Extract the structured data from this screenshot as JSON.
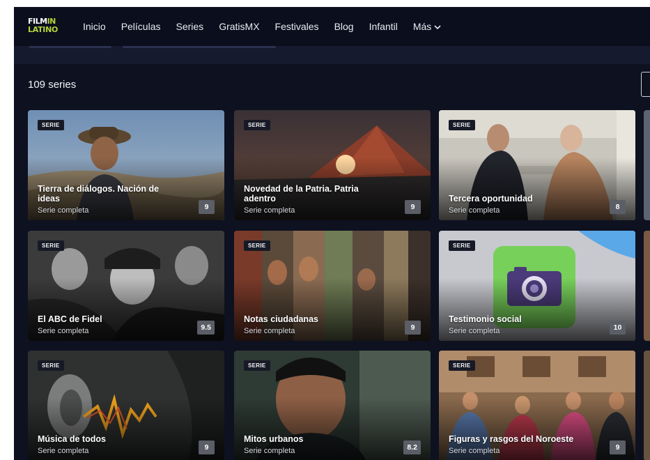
{
  "app": {
    "logo_line1_a": "FILM",
    "logo_line1_b": "IN",
    "logo_line2": "LATINO"
  },
  "nav": {
    "items": [
      {
        "label": "Inicio"
      },
      {
        "label": "Películas"
      },
      {
        "label": "Series"
      },
      {
        "label": "GratisMX"
      },
      {
        "label": "Festivales"
      },
      {
        "label": "Blog"
      },
      {
        "label": "Infantil"
      },
      {
        "label": "Más"
      }
    ]
  },
  "catalog": {
    "count_label": "109 series",
    "cards": [
      {
        "badge": "SERIE",
        "title": "Tierra de diálogos. Nación de ideas",
        "subtitle": "Serie completa",
        "rating": "9"
      },
      {
        "badge": "SERIE",
        "title": "Novedad de la Patria. Patria adentro",
        "subtitle": "Serie completa",
        "rating": "9"
      },
      {
        "badge": "SERIE",
        "title": "Tercera oportunidad",
        "subtitle": "Serie completa",
        "rating": "8"
      },
      {
        "badge": "SERIE",
        "title": "El ABC de Fidel",
        "subtitle": "Serie completa",
        "rating": "9.5"
      },
      {
        "badge": "SERIE",
        "title": "Notas ciudadanas",
        "subtitle": "Serie completa",
        "rating": "9"
      },
      {
        "badge": "SERIE",
        "title": "Testimonio social",
        "subtitle": "Serie completa",
        "rating": "10"
      },
      {
        "badge": "SERIE",
        "title": "Música de todos",
        "subtitle": "Serie completa",
        "rating": "9"
      },
      {
        "badge": "SERIE",
        "title": "Mitos urbanos",
        "subtitle": "Serie completa",
        "rating": "8.2"
      },
      {
        "badge": "SERIE",
        "title": "Figuras y rasgos del Noroeste",
        "subtitle": "Serie completa",
        "rating": "9"
      }
    ]
  },
  "colors": {
    "background": "#0e1120",
    "navbar": "#0b0e1c",
    "logo_accent": "#b5d33a",
    "rating_badge": "#5b5e66"
  }
}
